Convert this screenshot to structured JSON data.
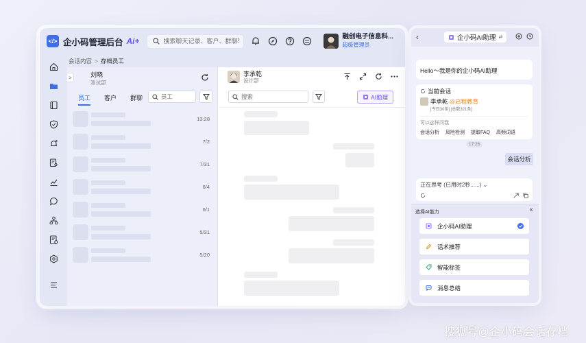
{
  "topbar": {
    "logo_glyph": "</>",
    "app_title": "企小码管理后台",
    "ai_badge": "Ai+",
    "search_placeholder": "搜索聊天记录、客户、群聊等",
    "org_name": "融创电子信息科...",
    "org_role": "超级管理员"
  },
  "breadcrumb": {
    "parent": "会话内容",
    "separator": ">",
    "current": "存档员工"
  },
  "nav_items": [
    "home-icon",
    "folder-icon",
    "book-icon",
    "shield-icon",
    "bell-icon",
    "doc-search-icon",
    "chart-icon",
    "chat-icon",
    "org-icon",
    "report-icon",
    "settings-icon",
    "menu-icon"
  ],
  "list_panel": {
    "collapse_glyph": ">",
    "contact_name": "刘晓",
    "contact_dept": "测试部",
    "tabs": [
      {
        "label": "员工",
        "active": true
      },
      {
        "label": "客户",
        "active": false
      },
      {
        "label": "群聊",
        "active": false
      }
    ],
    "search_placeholder": "员工",
    "rows": [
      {
        "time": "13:28"
      },
      {
        "time": "7/2"
      },
      {
        "time": "7/31"
      },
      {
        "time": "6/4"
      },
      {
        "time": "6/1"
      },
      {
        "time": "5/31"
      },
      {
        "time": "5/20"
      }
    ]
  },
  "chat_panel": {
    "name": "李承乾",
    "dept": "设计部",
    "search_placeholder": "搜索",
    "ai_button": "AI助理"
  },
  "ai_panel": {
    "back_glyph": "‹",
    "title": "企小码AI助理",
    "switch_glyph": "⇄",
    "greeting": "Hello～我是你的企小码AI助理",
    "session_caption": "当前会话",
    "session_person": "李承乾",
    "session_company": "@启程教育",
    "session_meta": "[今日30条] [总数321条]",
    "ask_title": "可以这样问我",
    "chips": [
      "会话分析",
      "风险检测",
      "提取FAQ",
      "高频词语"
    ],
    "time": "17:26",
    "user_message": "会话分析",
    "thinking": "正在思考 (已用时2秒......) ⌄",
    "select_title": "选择AI能力",
    "close_glyph": "×",
    "options": [
      {
        "label": "企小码AI助理",
        "selected": true
      },
      {
        "label": "话术推荐",
        "selected": false
      },
      {
        "label": "智能标签",
        "selected": false
      },
      {
        "label": "消息总结",
        "selected": false
      }
    ]
  },
  "watermark": "搜狐号@企小码会话存档",
  "colors": {
    "accent": "#3f6ee8",
    "ai_purple": "#6a55e8",
    "company_orange": "#e6902e",
    "sidebar_bg": "#e3e6f5"
  }
}
